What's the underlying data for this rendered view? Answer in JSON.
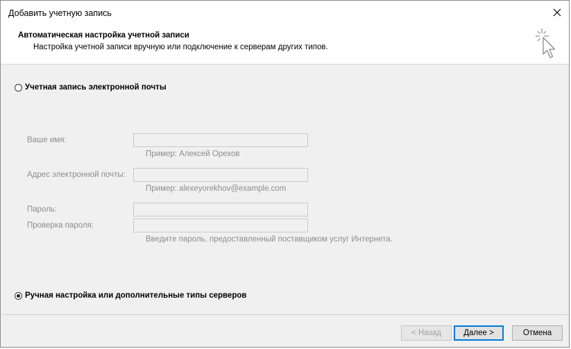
{
  "window": {
    "title": "Добавить учетную запись",
    "close_icon": "close-icon"
  },
  "header": {
    "title": "Автоматическая настройка учетной записи",
    "subtitle": "Настройка учетной записи вручную или подключение к серверам других типов.",
    "icon": "wizard-cursor-icon"
  },
  "options": {
    "email_account": {
      "label": "Учетная запись электронной почты",
      "checked": false
    },
    "manual_setup": {
      "label": "Ручная настройка или дополнительные типы серверов",
      "checked": true
    }
  },
  "form": {
    "name": {
      "label": "Ваше имя:",
      "value": "",
      "hint": "Пример: Алексей Орехов"
    },
    "email": {
      "label": "Адрес электронной почты:",
      "value": "",
      "hint": "Пример: alexeyorekhov@example.com"
    },
    "password": {
      "label": "Пароль:",
      "value": ""
    },
    "password_confirm": {
      "label": "Проверка пароля:",
      "value": ""
    },
    "password_hint": "Введите пароль, предоставленный поставщиком услуг Интернета."
  },
  "buttons": {
    "back": "< Назад",
    "next": "Далее >",
    "cancel": "Отмена"
  },
  "colors": {
    "accent": "#0078d7",
    "disabled_text": "#8d8d8d"
  }
}
